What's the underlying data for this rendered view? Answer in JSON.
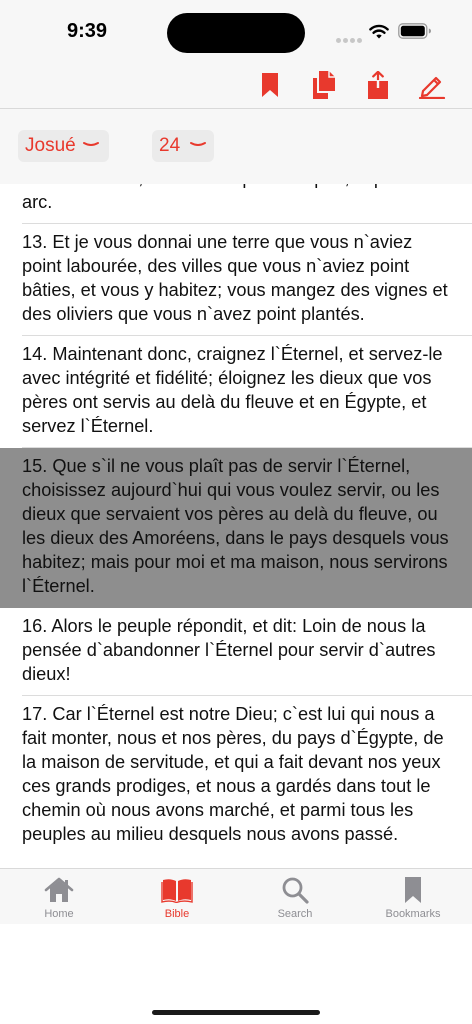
{
  "status_bar": {
    "time": "9:39"
  },
  "toolbar": {
    "icons": [
      "bookmark-icon",
      "copy-icon",
      "share-icon",
      "edit-icon"
    ]
  },
  "selectors": {
    "book": "Josué",
    "chapter": "24"
  },
  "verses": [
    {
      "text": "des Amoréens, ce ne fut ni par ton épée, ni par ton arc.",
      "selected": false
    },
    {
      "text": "13. Et je vous donnai une terre que vous n`aviez point labourée, des villes que vous n`aviez point bâties, et vous y habitez; vous mangez des vignes et des oliviers que vous n`avez point plantés.",
      "selected": false
    },
    {
      "text": "14. Maintenant donc, craignez l`Éternel, et servez-le avec intégrité et fidélité; éloignez les dieux que vos pères ont servis au delà du fleuve et en Égypte, et servez l`Éternel.",
      "selected": false
    },
    {
      "text": "15. Que s`il ne vous plaît pas de servir l`Éternel, choisissez aujourd`hui qui vous voulez servir, ou les dieux que servaient vos pères au delà du fleuve, ou les dieux des Amoréens, dans le pays desquels vous habitez; mais pour moi et ma maison, nous servirons l`Éternel.",
      "selected": true
    },
    {
      "text": "16. Alors le peuple répondit, et dit: Loin de nous la pensée d`abandonner l`Éternel pour servir d`autres dieux!",
      "selected": false
    },
    {
      "text": "17. Car l`Éternel est notre Dieu; c`est lui qui nous a fait monter, nous et nos pères, du pays d`Égypte, de la maison de servitude, et qui a fait devant nos yeux ces grands prodiges, et nous a gardés dans tout le chemin où nous avons marché, et parmi tous les peuples au milieu desquels nous avons passé.",
      "selected": false
    }
  ],
  "tabs": [
    {
      "label": "Home",
      "icon": "home-icon",
      "active": false
    },
    {
      "label": "Bible",
      "icon": "book-icon",
      "active": true
    },
    {
      "label": "Search",
      "icon": "search-icon",
      "active": false
    },
    {
      "label": "Bookmarks",
      "icon": "bookmark-icon",
      "active": false
    }
  ],
  "colors": {
    "accent": "#e8392d",
    "selected_row": "#8e8e8e",
    "inactive_tab": "#8e8e93"
  }
}
